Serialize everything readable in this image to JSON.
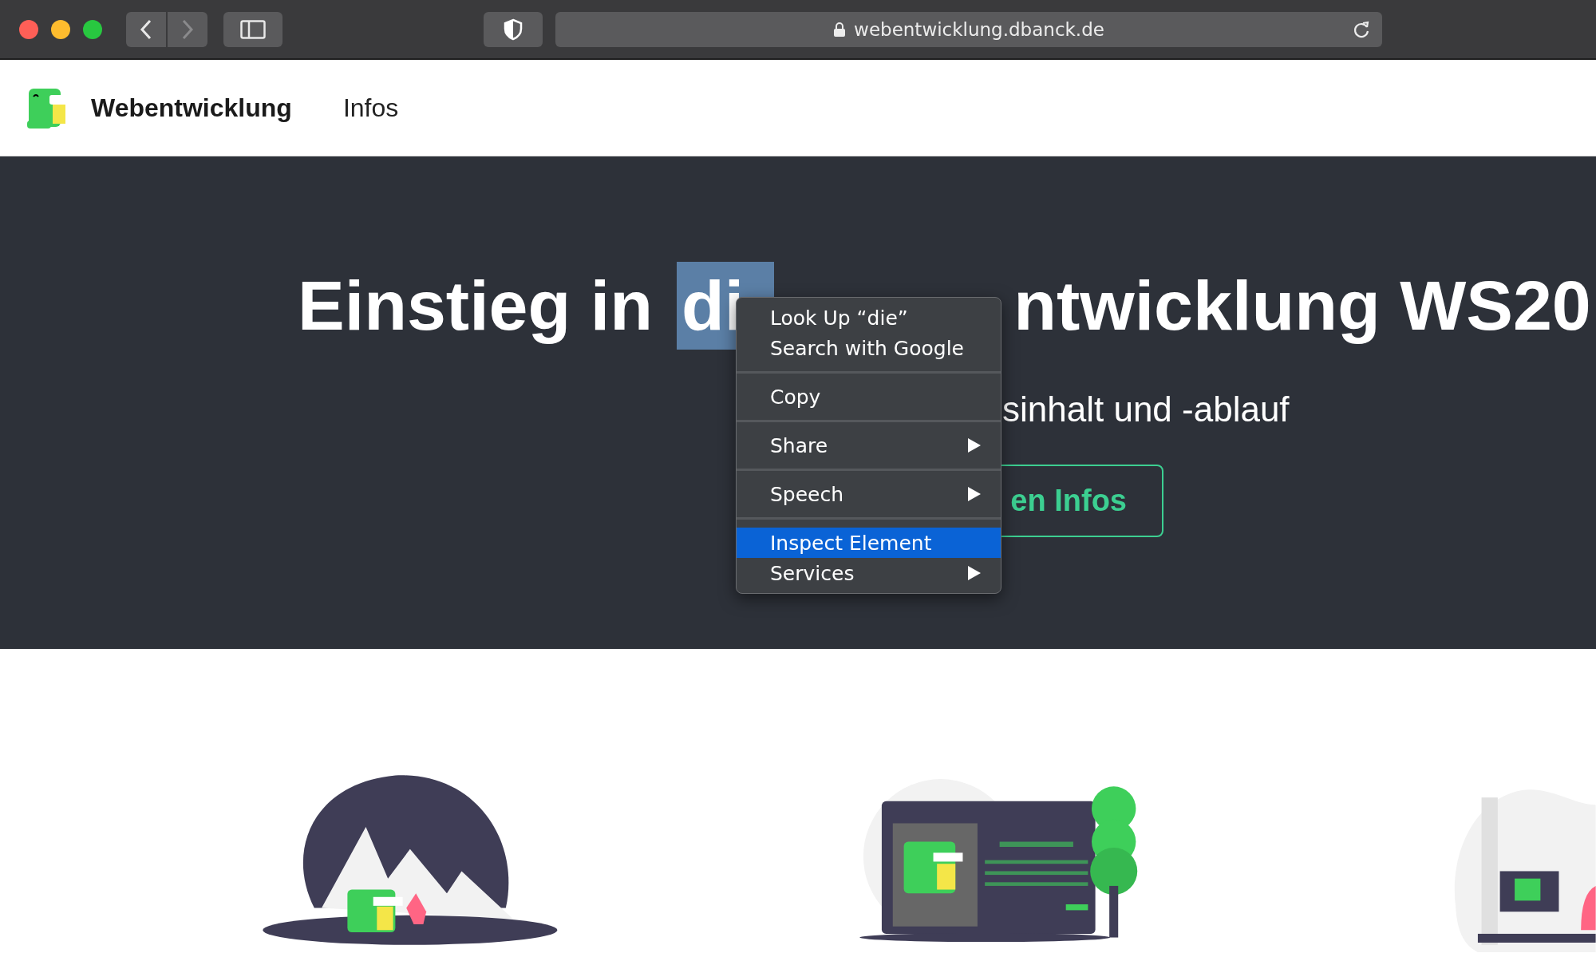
{
  "browser": {
    "address": "webentwicklung.dbanck.de",
    "back_enabled": true,
    "forward_enabled": false
  },
  "nav": {
    "brand": "Webentwicklung",
    "links": [
      "Infos"
    ]
  },
  "hero": {
    "heading_start": "Einstieg in",
    "heading_selected": "di",
    "heading_end": "ntwicklung WS20",
    "subtitle": "sinhalt und -ablauf",
    "button": "en Infos"
  },
  "context_menu": [
    [
      {
        "label": "Look Up “die”",
        "submenu": false,
        "selected": false
      },
      {
        "label": "Search with Google",
        "submenu": false,
        "selected": false
      }
    ],
    [
      {
        "label": "Copy",
        "submenu": false,
        "selected": false
      }
    ],
    [
      {
        "label": "Share",
        "submenu": true,
        "selected": false
      }
    ],
    [
      {
        "label": "Speech",
        "submenu": true,
        "selected": false
      }
    ],
    [
      {
        "label": "Inspect Element",
        "submenu": false,
        "selected": true
      },
      {
        "label": "Services",
        "submenu": true,
        "selected": false
      }
    ]
  ]
}
